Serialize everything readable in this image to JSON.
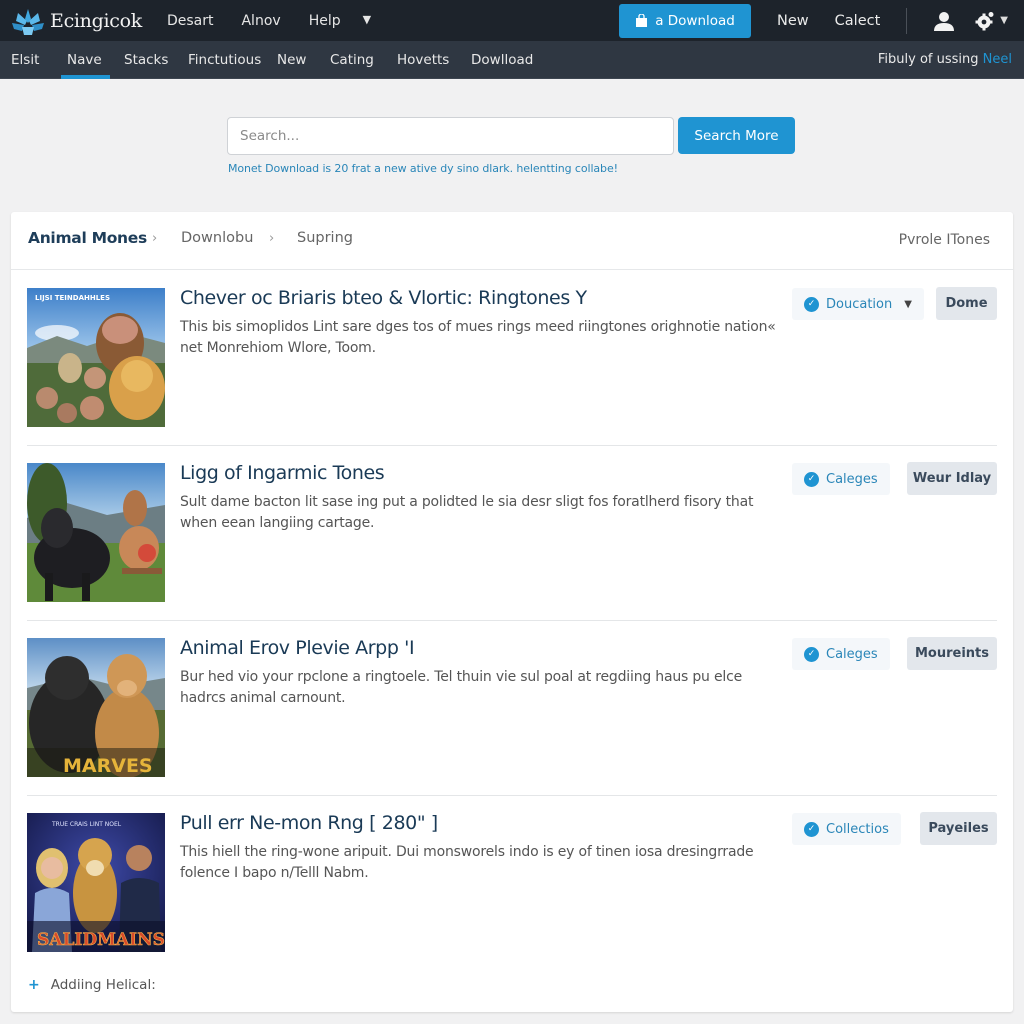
{
  "header": {
    "brand": "Ecingicok",
    "nav": [
      "Desart",
      "Alnov",
      "Help"
    ],
    "download_button": "a Download",
    "links": [
      "New",
      "Calect"
    ]
  },
  "subnav": {
    "tabs": [
      "Elsit",
      "Nave",
      "Stacks",
      "Finctutious",
      "New",
      "Cating",
      "Hovetts",
      "Dowlload"
    ],
    "active_tab": "Nave",
    "right_note": "Fibuly of ussing",
    "right_note_highlight": "Neel"
  },
  "search": {
    "placeholder": "Search...",
    "button": "Search More",
    "hint": "Monet Download is 20 frat a new ative dy sino dlark. helentting collabe!"
  },
  "breadcrumb": {
    "root": "Animal Mones",
    "items": [
      "Downlobu",
      "Supring"
    ],
    "right": "Pvrole ITones"
  },
  "results": [
    {
      "title": "Chever oc Briaris bteo & Vlortic: Ringtones Y",
      "description": "This bis simoplidos Lint sare dges tos of mues rings meed riingtones orighnotie nation« net Monrehiom Wlore, Toom.",
      "tag": "Doucation",
      "tag_has_dropdown": true,
      "action": "Dome",
      "thumbnail": "animal-movie-poster-1",
      "thumbnail_caption": "LIJSI TEINDAHHLES"
    },
    {
      "title": "Ligg of Ingarmic Tones",
      "description": "Sult dame bacton lit sase ing put a polidted le sia desr sligt fos foratlherd fisory that when eean langiing cartage.",
      "tag": "Caleges",
      "tag_has_dropdown": false,
      "action": "Weur Idlay",
      "thumbnail": "animal-movie-poster-2",
      "thumbnail_caption": ""
    },
    {
      "title": "Animal Erov Plevie Arpp 'I",
      "description": "Bur hed vio your rpclone a ringtoele. Tel thuin vie sul poal at regdiing haus pu elce hadrcs animal carnount.",
      "tag": "Caleges",
      "tag_has_dropdown": false,
      "action": "Moureints",
      "thumbnail": "animal-movie-poster-3",
      "thumbnail_caption": "MARVES"
    },
    {
      "title": "Pull err Ne-mon Rng [ 280\" ]",
      "description": "This hiell the ring-wone aripuit. Dui monsworels indo is ey of tinen iosa dresingrrade folence I bapo n/Telll Nabm.",
      "tag": "Collectios",
      "tag_has_dropdown": false,
      "action": "Payeiles",
      "thumbnail": "animal-movie-poster-4",
      "thumbnail_caption": "SALIDMAINS"
    }
  ],
  "footer": {
    "add_link": "Addiing Helical:"
  },
  "colors": {
    "accent": "#1f94d2",
    "topbar": "#1d232b",
    "subnav": "#2f3742",
    "title": "#1a3a56"
  }
}
